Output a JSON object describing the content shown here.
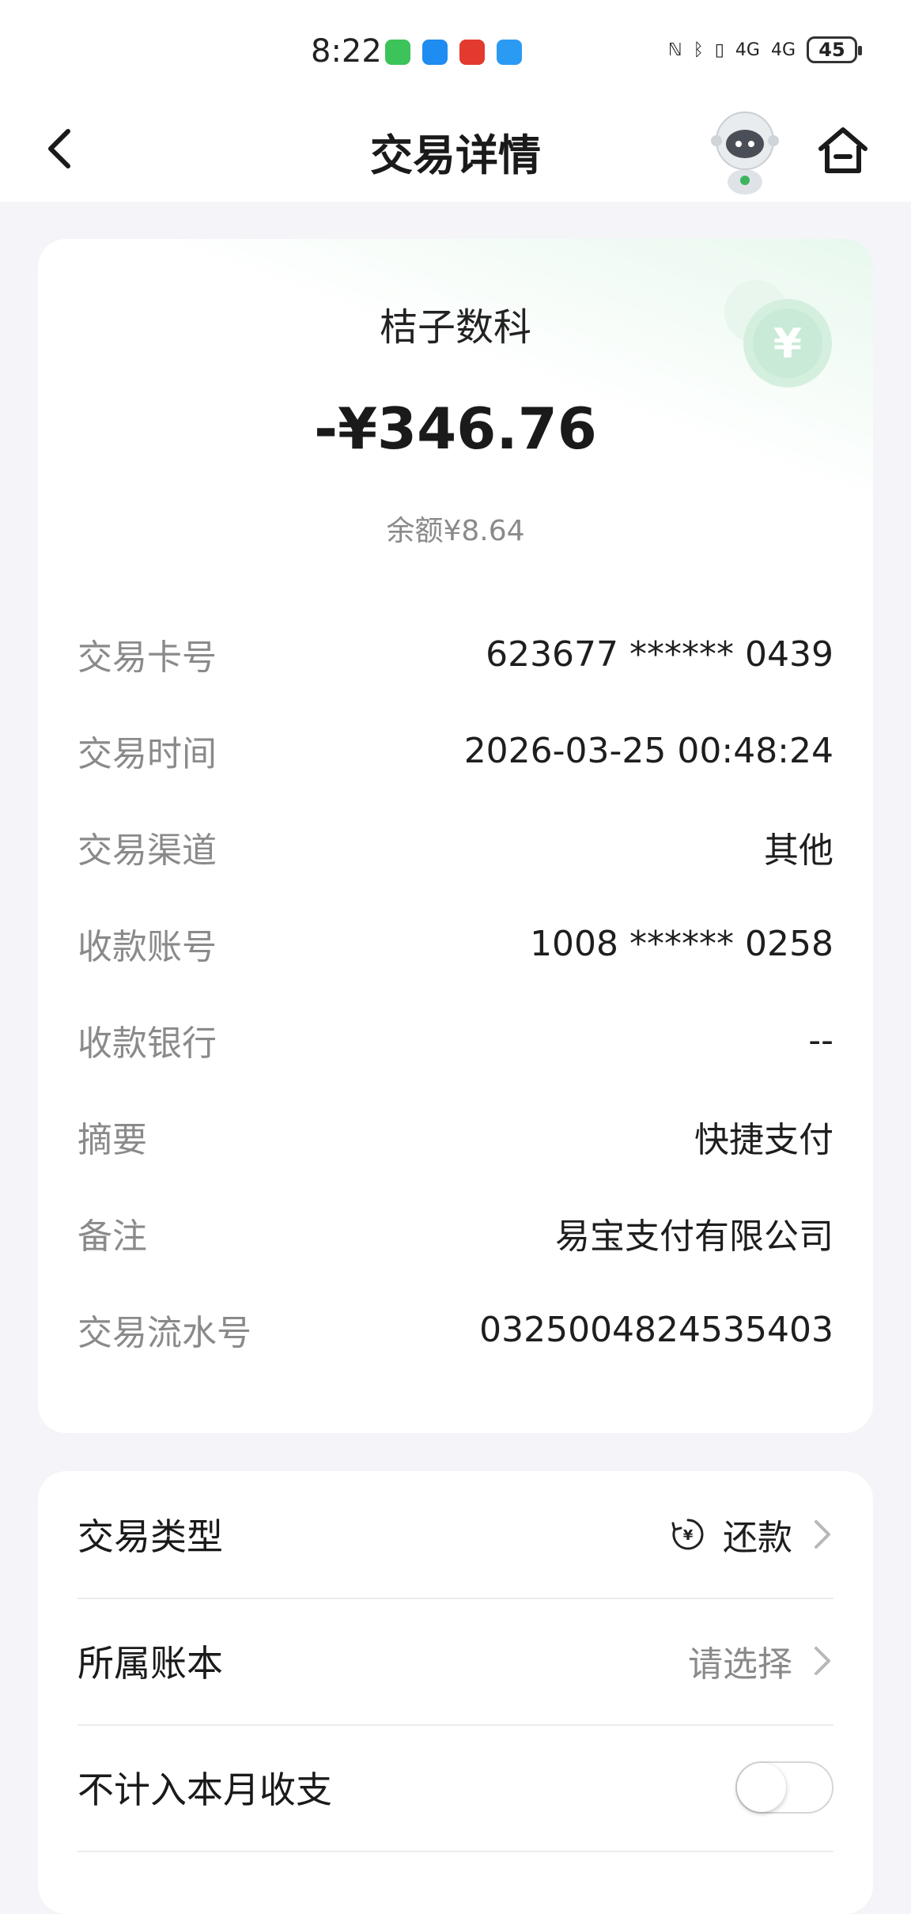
{
  "status_bar": {
    "time": "8:22",
    "battery": "45",
    "network_1": "4G",
    "network_2": "4G"
  },
  "nav": {
    "title": "交易详情",
    "back_icon": "chevron-left-icon",
    "home_icon": "home-icon",
    "assistant_icon": "robot-assistant-icon"
  },
  "summary": {
    "merchant": "桔子数科",
    "amount": "-¥346.76",
    "balance": "余额¥8.64"
  },
  "details": [
    {
      "label": "交易卡号",
      "value": "623677 ****** 0439"
    },
    {
      "label": "交易时间",
      "value": "2026-03-25 00:48:24"
    },
    {
      "label": "交易渠道",
      "value": "其他"
    },
    {
      "label": "收款账号",
      "value": "1008 ****** 0258"
    },
    {
      "label": "收款银行",
      "value": "--"
    },
    {
      "label": "摘要",
      "value": "快捷支付"
    },
    {
      "label": "备注",
      "value": "易宝支付有限公司"
    },
    {
      "label": "交易流水号",
      "value": "0325004824535403"
    }
  ],
  "settings": {
    "type": {
      "label": "交易类型",
      "value": "还款"
    },
    "book": {
      "label": "所属账本",
      "value": "请选择"
    },
    "exclude": {
      "label": "不计入本月收支",
      "enabled": false
    }
  },
  "colors": {
    "accent_green": "#4cc27a",
    "background": "#f4f4f9"
  }
}
